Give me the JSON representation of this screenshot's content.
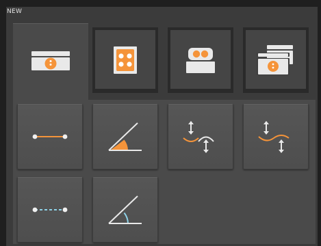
{
  "panel": {
    "title": "NEW"
  },
  "colors": {
    "accent": "#f5943a",
    "accent_alt": "#8fd3e8",
    "icon": "#e9e9e9"
  },
  "tabs": [
    {
      "icon": "single-object-icon",
      "active": true
    },
    {
      "icon": "grid-four-icon",
      "active": false
    },
    {
      "icon": "two-object-icon",
      "active": false
    },
    {
      "icon": "stacked-objects-icon",
      "active": false
    }
  ],
  "tools": [
    {
      "icon": "distance-line-icon"
    },
    {
      "icon": "angle-filled-icon"
    },
    {
      "icon": "vertical-arc-icon"
    },
    {
      "icon": "vertical-wave-icon"
    },
    {
      "icon": "dashed-line-icon"
    },
    {
      "icon": "angle-arc-icon"
    }
  ]
}
